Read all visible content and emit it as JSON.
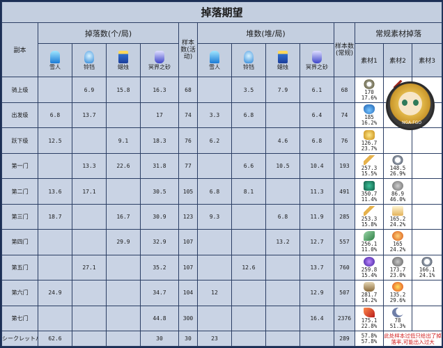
{
  "title": "掉落期望",
  "headers": {
    "stage": "副本",
    "drop_group": "掉落数(个/局)",
    "sample_event": "样本数(活动)",
    "stack_group": "堆数(堆/局)",
    "sample_regular": "样本数(常规)",
    "mat_group": "常规素材掉落",
    "items": [
      "雪人",
      "铃铛",
      "蜡烛",
      "冥界之砂"
    ],
    "mats": [
      "素材1",
      "素材2",
      "素材3"
    ]
  },
  "rows": [
    {
      "stage": "骑上级",
      "d": [
        "",
        "6.9",
        "15.8",
        "16.3"
      ],
      "se": "68",
      "s": [
        "",
        "3.5",
        "7.9",
        "6.1"
      ],
      "sr": "68",
      "m1": [
        "170",
        "17.6%"
      ],
      "m2": [
        "255",
        "11.8%"
      ],
      "m3": [
        "",
        ""
      ]
    },
    {
      "stage": "出发级",
      "d": [
        "6.8",
        "13.7",
        "",
        "17"
      ],
      "se": "74",
      "s": [
        "3.3",
        "6.8",
        "",
        "6.4"
      ],
      "sr": "74",
      "m1": [
        "185",
        "16.2%"
      ],
      "m2": [
        "",
        ""
      ],
      "m3": [
        "",
        ""
      ]
    },
    {
      "stage": "跃下级",
      "d": [
        "12.5",
        "",
        "9.1",
        "18.3"
      ],
      "se": "76",
      "s": [
        "6.2",
        "",
        "4.6",
        "6.8"
      ],
      "sr": "76",
      "m1": [
        "126.7",
        "23.7%"
      ],
      "m2": [
        "",
        ""
      ],
      "m3": [
        "",
        ""
      ]
    },
    {
      "stage": "第一门",
      "d": [
        "",
        "13.3",
        "22.6",
        "31.8"
      ],
      "se": "77",
      "s": [
        "",
        "6.6",
        "10.5",
        "10.4"
      ],
      "sr": "193",
      "m1": [
        "257.3",
        "15.5%"
      ],
      "m2": [
        "148.5",
        "26.9%"
      ],
      "m3": [
        "",
        ""
      ]
    },
    {
      "stage": "第二门",
      "d": [
        "13.6",
        "17.1",
        "",
        "30.5"
      ],
      "se": "105",
      "s": [
        "6.8",
        "8.1",
        "",
        "11.3"
      ],
      "sr": "491",
      "m1": [
        "350.7",
        "11.4%"
      ],
      "m2": [
        "86.9",
        "46.0%"
      ],
      "m3": [
        "",
        ""
      ]
    },
    {
      "stage": "第三门",
      "d": [
        "18.7",
        "",
        "16.7",
        "30.9"
      ],
      "se": "123",
      "s": [
        "9.3",
        "",
        "6.8",
        "11.9"
      ],
      "sr": "285",
      "m1": [
        "253.3",
        "15.8%"
      ],
      "m2": [
        "165.2",
        "24.2%"
      ],
      "m3": [
        "",
        ""
      ]
    },
    {
      "stage": "第四门",
      "d": [
        "",
        "",
        "29.9",
        "32.9"
      ],
      "se": "107",
      "s": [
        "",
        "",
        "13.2",
        "12.7"
      ],
      "sr": "557",
      "m1": [
        "256.1",
        "11.0%"
      ],
      "m2": [
        "165",
        "24.2%"
      ],
      "m3": [
        "",
        ""
      ]
    },
    {
      "stage": "第五门",
      "d": [
        "",
        "27.1",
        "",
        "35.2"
      ],
      "se": "107",
      "s": [
        "",
        "12.6",
        "",
        "13.7"
      ],
      "sr": "760",
      "m1": [
        "259.8",
        "15.4%"
      ],
      "m2": [
        "173.7",
        "23.0%"
      ],
      "m3": [
        "166.1",
        "24.1%"
      ]
    },
    {
      "stage": "第六门",
      "d": [
        "24.9",
        "",
        "",
        "34.7"
      ],
      "se": "104",
      "s": [
        "12",
        "",
        "",
        "12.9"
      ],
      "sr": "507",
      "m1": [
        "281.7",
        "14.2%"
      ],
      "m2": [
        "135.2",
        "29.6%"
      ],
      "m3": [
        "",
        ""
      ]
    },
    {
      "stage": "第七门",
      "d": [
        "",
        "",
        "",
        "44.8"
      ],
      "se": "300",
      "s": [
        "",
        "",
        "",
        "16.4"
      ],
      "sr": "2376",
      "m1": [
        "175.1",
        "22.8%"
      ],
      "m2": [
        "78",
        "51.3%"
      ],
      "m3": [
        "",
        ""
      ]
    },
    {
      "stage": "シークレットパーティー",
      "d": [
        "62.6",
        "",
        "",
        "30"
      ],
      "se": "30",
      "s": [
        "23",
        "",
        "",
        ""
      ],
      "sr": "289",
      "m1": [
        "",
        "57.8%"
      ],
      "m2": [
        "此处样本过低只给出了掉落率,可能出入过大",
        ""
      ],
      "m3": [
        "",
        ""
      ]
    }
  ],
  "avatar_text": "NGA-FGO",
  "colors": {
    "bg": "#1c2f55",
    "cell": "#c9d3e4",
    "header": "#c4cfe0",
    "note": "#d01818"
  }
}
